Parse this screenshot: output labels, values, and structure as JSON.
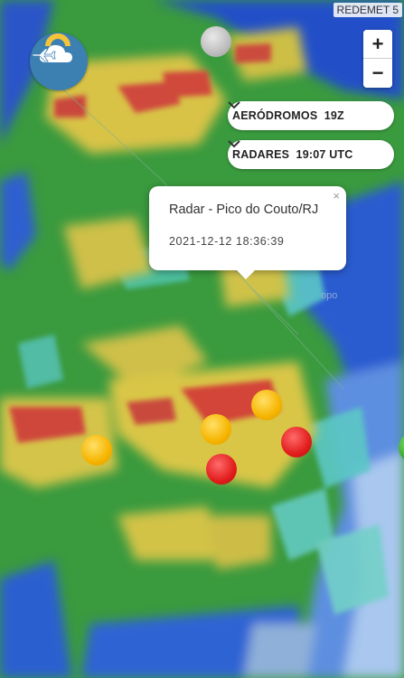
{
  "app": {
    "version_label": "REDEMET 5"
  },
  "logo": {
    "icon": "plane-cloud-sun-icon",
    "colors": {
      "bg": "#3c7fb1",
      "sun": "#f5c43a",
      "cloud": "#ffffff"
    }
  },
  "zoom": {
    "in_label": "+",
    "out_label": "−"
  },
  "layers": {
    "aerodromos": {
      "label": "AERÓDROMOS  19Z"
    },
    "radares": {
      "label": "RADARES  19:07 UTC"
    }
  },
  "popup": {
    "close_label": "×",
    "title": "Radar - Pico do Couto/RJ",
    "timestamp": "2021-12-12 18:36:39"
  },
  "markers": [
    {
      "color": "grey",
      "status": "no-data"
    },
    {
      "color": "yellow",
      "status": "moderate"
    },
    {
      "color": "yellow",
      "status": "moderate"
    },
    {
      "color": "yellow",
      "status": "moderate"
    },
    {
      "color": "red",
      "status": "severe"
    },
    {
      "color": "red",
      "status": "severe"
    },
    {
      "color": "green",
      "status": "normal"
    }
  ],
  "map": {
    "label_fragment": "opo"
  },
  "colors": {
    "rain_light": "#46b04a",
    "rain_moderate": "#d8c84a",
    "rain_heavy": "#d2453c",
    "ocean": "#1f4fcf"
  }
}
